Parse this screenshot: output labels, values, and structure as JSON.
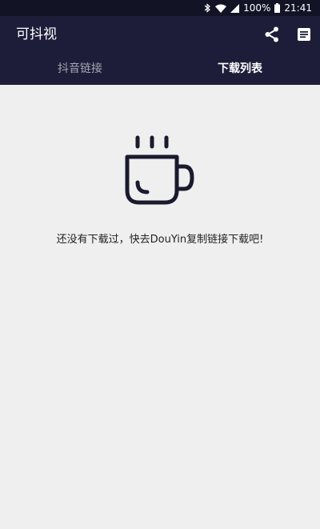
{
  "status_bar": {
    "battery": "100%",
    "time": "21:41"
  },
  "app_bar": {
    "title": "可抖视"
  },
  "tabs": [
    {
      "label": "抖音链接",
      "active": false
    },
    {
      "label": "下载列表",
      "active": true
    }
  ],
  "empty_state": {
    "message": "还没有下载过，快去DouYin复制链接下载吧!"
  },
  "colors": {
    "status_bar_bg": "#131326",
    "app_bar_bg": "#1e1d39",
    "content_bg": "#efefef"
  }
}
